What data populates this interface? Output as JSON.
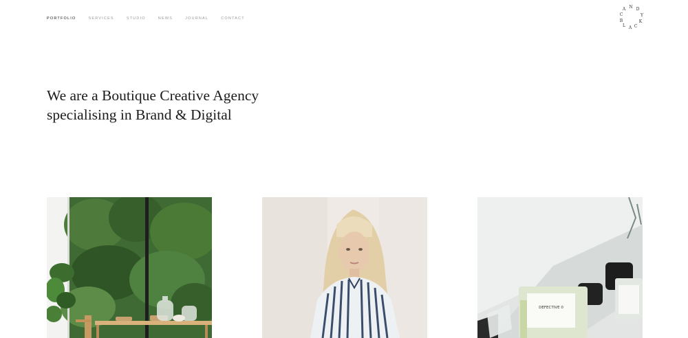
{
  "nav": {
    "items": [
      {
        "label": "PORTFOLIO",
        "active": true
      },
      {
        "label": "SERVICES",
        "active": false
      },
      {
        "label": "STUDIO",
        "active": false
      },
      {
        "label": "NEWS",
        "active": false
      },
      {
        "label": "JOURNAL",
        "active": false
      },
      {
        "label": "CONTACT",
        "active": false
      }
    ]
  },
  "logo": {
    "letters": [
      "A",
      "N",
      "D",
      "Y",
      "K",
      "C",
      "A",
      "L",
      "B",
      "C"
    ]
  },
  "hero": {
    "line1": "We are a Boutique Creative Agency",
    "line2": "specialising in Brand & Digital"
  },
  "portfolio": {
    "items": [
      {
        "image": "garden-dining-room-photo"
      },
      {
        "image": "blonde-woman-striped-shirt-photo"
      },
      {
        "image": "perfume-bottles-photo"
      }
    ]
  },
  "product_labels": {
    "bottle_front": "DEFECTIVE 0"
  }
}
